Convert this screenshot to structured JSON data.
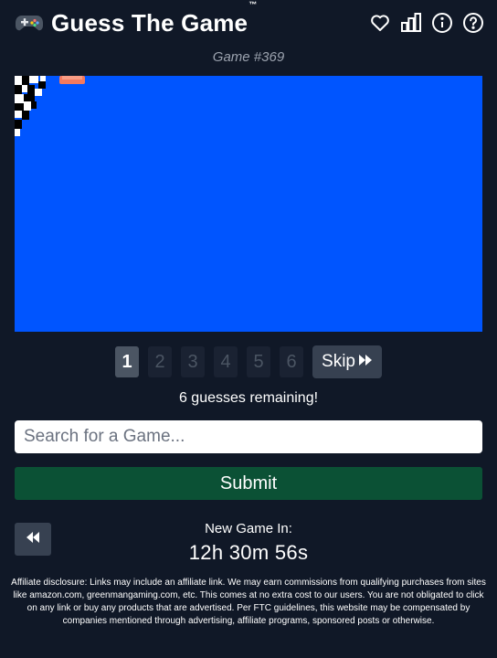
{
  "header": {
    "logo_icon": "game-controller-icon",
    "title": "Guess The Game",
    "trademark": "™",
    "icons": [
      "heart-icon",
      "bar-chart-icon",
      "info-icon",
      "help-icon"
    ]
  },
  "game": {
    "number_label": "Game #369"
  },
  "screenshot": {
    "background_color": "#0055ff"
  },
  "attempts": {
    "items": [
      "1",
      "2",
      "3",
      "4",
      "5",
      "6"
    ],
    "active_index": 0,
    "skip_label": "Skip",
    "skip_icon": "fast-forward-icon"
  },
  "status": {
    "remaining_text": "6 guesses remaining!"
  },
  "search": {
    "placeholder": "Search for a Game..."
  },
  "submit": {
    "label": "Submit"
  },
  "footer": {
    "back_icon": "rewind-icon",
    "new_game_label": "New Game In:",
    "countdown": "12h 30m 56s",
    "disclaimer": "Affiliate disclosure: Links may include an affiliate link. We may earn commissions from qualifying purchases from sites like amazon.com, greenmangaming.com, etc. This comes at no extra cost to our users. You are not obligated to click on any link or buy any products that are advertised. Per FTC guidelines, this website may be compensated by companies mentioned through advertising, affiliate programs, sponsored posts or otherwise."
  },
  "colors": {
    "background": "#101827",
    "submit": "#0b5135",
    "button_gray": "#374151"
  }
}
